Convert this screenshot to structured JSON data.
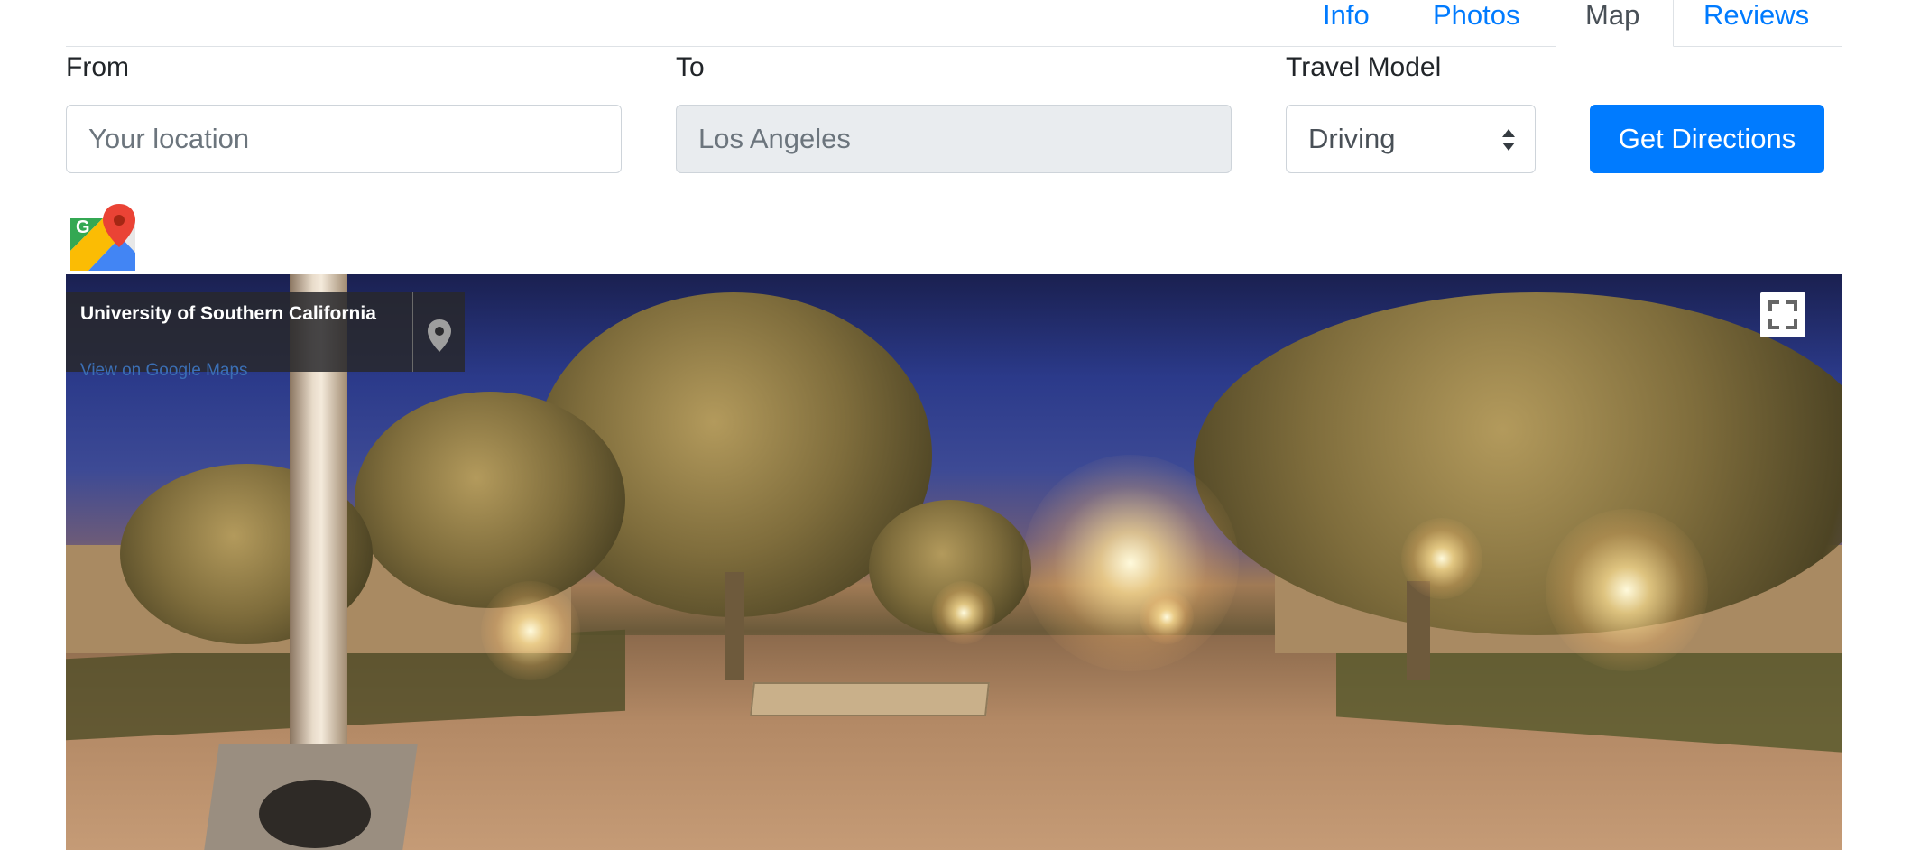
{
  "tabs": [
    {
      "label": "Info"
    },
    {
      "label": "Photos"
    },
    {
      "label": "Map"
    },
    {
      "label": "Reviews"
    }
  ],
  "form": {
    "from_label": "From",
    "from_placeholder": "Your location",
    "to_label": "To",
    "to_value": "Los Angeles",
    "mode_label": "Travel Model",
    "mode_selected": "Driving",
    "submit_label": "Get Directions"
  },
  "streetview": {
    "place_name": "University of Southern California",
    "link_text": "View on Google Maps"
  },
  "colors": {
    "accent": "#007bff",
    "readonly_bg": "#e9ecef"
  },
  "icons": [
    "google-maps-icon",
    "map-pin-icon",
    "fullscreen-icon",
    "select-arrows-icon"
  ]
}
